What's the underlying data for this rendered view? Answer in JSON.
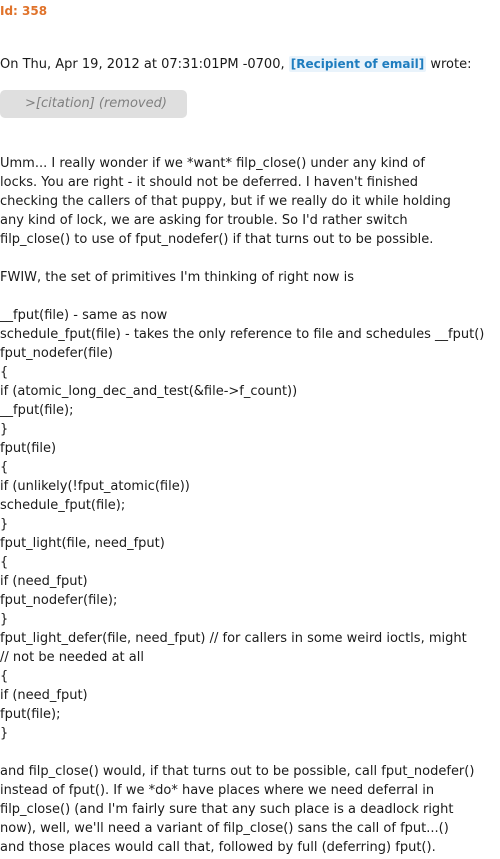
{
  "meta": {
    "id_label": "Id: 358"
  },
  "header": {
    "prefix": "On Thu, Apr 19, 2012 at 07:31:01PM -0700, ",
    "recipient": "[Recipient of email]",
    "suffix": " wrote:"
  },
  "citation": {
    "text": ">[citation] (removed)"
  },
  "body": {
    "para1": [
      "Umm... I really wonder if we *want* filp_close() under any kind of",
      "locks. You are right - it should not be deferred. I haven't finished",
      "checking the callers of that puppy, but if we really do it while holding",
      "any kind of lock, we are asking for trouble. So I'd rather switch",
      "filp_close() to use of fput_nodefer() if that turns out to be possible."
    ],
    "para2": [
      "FWIW, the set of primitives I'm thinking of right now is"
    ],
    "code": [
      "__fput(file) - same as now",
      "schedule_fput(file) - takes the only reference to file and schedules __fput()",
      "fput_nodefer(file)",
      "{",
      "if (atomic_long_dec_and_test(&file->f_count))",
      "__fput(file);",
      "}",
      "fput(file)",
      "{",
      "if (unlikely(!fput_atomic(file))",
      "schedule_fput(file);",
      "}",
      "fput_light(file, need_fput)",
      "{",
      "if (need_fput)",
      "fput_nodefer(file);",
      "}",
      "fput_light_defer(file, need_fput) // for callers in some weird ioctls, might",
      "// not be needed at all",
      "{",
      "if (need_fput)",
      "fput(file);",
      "}"
    ],
    "para3": [
      "and filp_close() would, if that turns out to be possible, call fput_nodefer()",
      "instead of fput(). If we *do* have places where we need deferral in",
      "filp_close() (and I'm fairly sure that any such place is a deadlock right",
      "now), well, we'll need a variant of filp_close() sans the call of fput...()",
      "and those places would call that, followed by full (deferring) fput()."
    ]
  }
}
